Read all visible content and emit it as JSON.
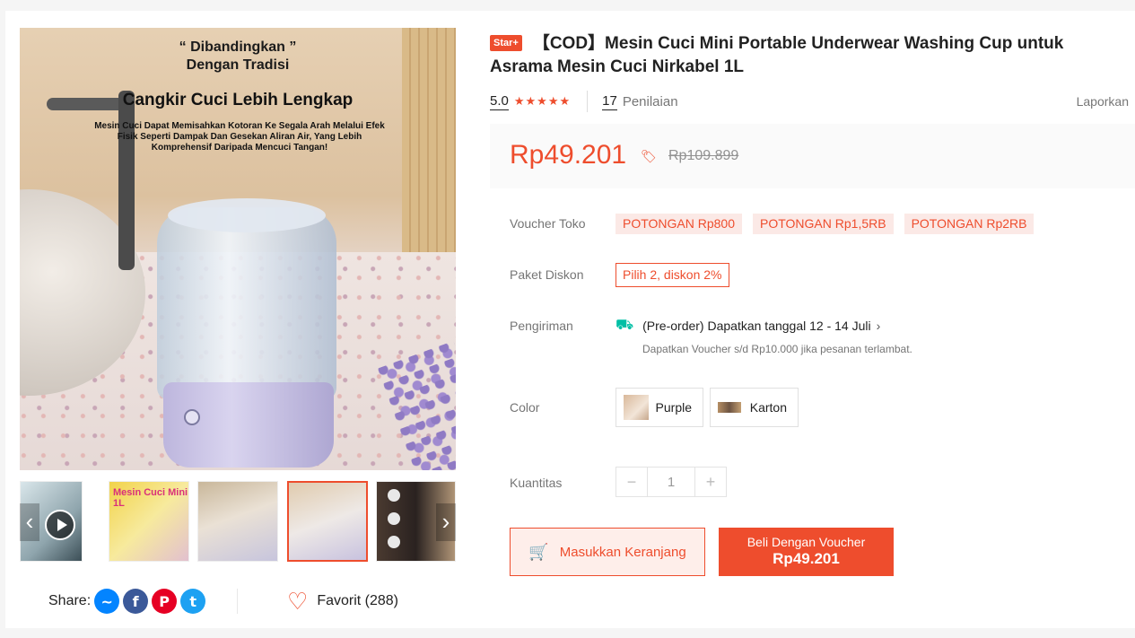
{
  "product": {
    "badge": "Star+",
    "title": "【COD】Mesin Cuci Mini Portable Underwear Washing Cup untuk Asrama Mesin Cuci Nirkabel 1L",
    "rating": "5.0",
    "stars": "★★★★★",
    "review_count": "17",
    "review_label": "Penilaian",
    "report_label": "Laporkan"
  },
  "price": {
    "current": "Rp49.201",
    "original": "Rp109.899"
  },
  "main_image": {
    "quote": "“ Dibandingkan ”\nDengan Tradisi",
    "headline": "Cangkir Cuci Lebih Lengkap",
    "body": "Mesin Cuci Dapat Memisahkan Kotoran Ke Segala Arah Melalui Efek Fisik Seperti Dampak Dan Gesekan Aliran Air, Yang Lebih Komprehensif Daripada Mencuci Tangan!"
  },
  "thumbnails": {
    "thumb2_label": "Mesin Cuci Mini 1L"
  },
  "share": {
    "label": "Share:",
    "favorite_label": "Favorit (288)"
  },
  "voucher": {
    "label": "Voucher Toko",
    "items": [
      "POTONGAN Rp800",
      "POTONGAN Rp1,5RB",
      "POTONGAN Rp2RB"
    ]
  },
  "bundle": {
    "label": "Paket Diskon",
    "value": "Pilih 2, diskon 2%"
  },
  "shipping": {
    "label": "Pengiriman",
    "main": "(Pre-order) Dapatkan tanggal 12 - 14 Juli",
    "sub": "Dapatkan Voucher s/d Rp10.000 jika pesanan terlambat."
  },
  "color": {
    "label": "Color",
    "options": [
      "Purple",
      "Karton"
    ]
  },
  "quantity": {
    "label": "Kuantitas",
    "value": "1"
  },
  "actions": {
    "cart_label": "Masukkan Keranjang",
    "buy_label": "Beli Dengan Voucher",
    "buy_price": "Rp49.201"
  },
  "colors": {
    "accent": "#ee4d2d",
    "shipping_icon": "#00bfa5"
  }
}
